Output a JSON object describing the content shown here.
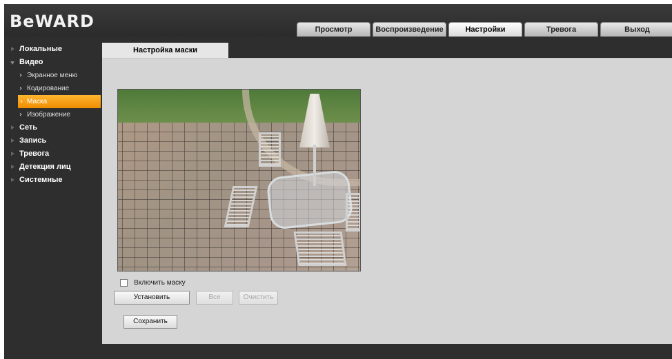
{
  "app": {
    "logo": "BeWARD"
  },
  "header": {
    "tabs": [
      {
        "label": "Просмотр"
      },
      {
        "label": "Воспроизведение"
      },
      {
        "label": "Настройки"
      },
      {
        "label": "Тревога"
      },
      {
        "label": "Выход"
      }
    ],
    "active_tab": "Настройки"
  },
  "sidebar": {
    "items": [
      {
        "label": "Локальные"
      },
      {
        "label": "Видео"
      },
      {
        "label": "Экранное меню"
      },
      {
        "label": "Кодирование"
      },
      {
        "label": "Маска"
      },
      {
        "label": "Изображение"
      },
      {
        "label": "Сеть"
      },
      {
        "label": "Запись"
      },
      {
        "label": "Тревога"
      },
      {
        "label": "Детекция лиц"
      },
      {
        "label": "Системные"
      }
    ],
    "active_item": "Маска"
  },
  "main": {
    "tab_title": "Настройка маски",
    "enable_mask_label": "Включить маску",
    "enable_mask_checked": false,
    "set_button": "Установить",
    "all_button": "Все",
    "clear_button": "Очистить",
    "save_button": "Сохранить"
  },
  "colors": {
    "accent": "#f5a000",
    "panel": "#d5d5d5",
    "frame": "#2e2e2e"
  }
}
